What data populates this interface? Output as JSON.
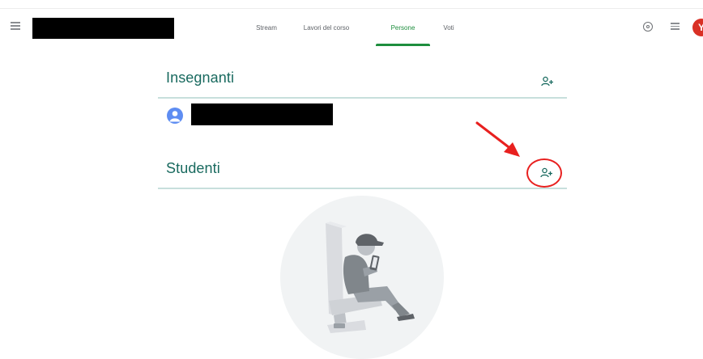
{
  "tabs": [
    {
      "label": "Stream",
      "active": false
    },
    {
      "label": "Lavori del corso",
      "active": false
    },
    {
      "label": "Persone",
      "active": true
    },
    {
      "label": "Voti",
      "active": false
    }
  ],
  "account": {
    "initial": "Y",
    "color": "#d93025"
  },
  "teachers_section": {
    "title": "Insegnanti"
  },
  "students_section": {
    "title": "Studenti"
  },
  "icons": {
    "menu": "hamburger-menu-icon",
    "settings": "gear-icon",
    "apps": "apps-menu-icon",
    "invite": "person-add-icon"
  },
  "colors": {
    "accent": "#1e8e3e",
    "section_title": "#196a5f",
    "annotation": "#e8201f"
  }
}
